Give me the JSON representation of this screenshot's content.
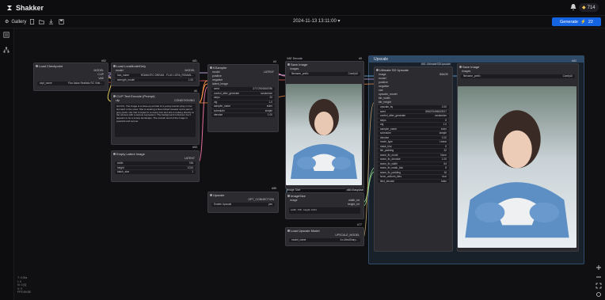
{
  "app": {
    "brand": "Shakker",
    "credits": "714"
  },
  "toolbar": {
    "gallery_label": "Gallery",
    "datetime": "2024-11-13 13:11:00",
    "generate_label": "Generate",
    "generate_cost": "22"
  },
  "stats": [
    "T: 0.09s",
    "I: 0",
    "N: 0 [0]",
    "V: 0",
    "FPS:59.88"
  ],
  "nodes": {
    "load_checkpoint": {
      "id": "#52",
      "title": "Load Checkpoint",
      "outputs": [
        "MODEL",
        "CLIP",
        "VAE"
      ],
      "ckpt_label": "ckpt_name",
      "ckpt_value": "Flux Asian Realistic RC Vide..."
    },
    "load_lora": {
      "id": "#81",
      "title": "Load LoraModelOnly",
      "input": "model",
      "output": "MODEL",
      "lora_label": "lora_name",
      "lora_value": "ROMANTIC DREAM - FLUX LORA_ROMAN...",
      "strength_label": "strength_model",
      "strength_value": "1.00"
    },
    "clip_text": {
      "id": "#6",
      "title": "CLIP Text Encode (Prompt)",
      "input": "clip",
      "output": "CONDITIONING",
      "text": "Girl thin, The image is a close-up portrait of a young woman lying on her stomach in the snow. She is wearing a blue knitted sweater and a pair of grey pants. Her hair is styled in a messy bun and she is looking directly at the camera with a serious expression. The background is blurred, but it appears to be a snowy landscape. The overall mood of the image is peaceful and serene."
    },
    "empty_latent": {
      "id": "#53",
      "title": "Empty Latent Image",
      "output": "LATENT",
      "width_label": "width",
      "width_value": "768",
      "height_label": "height",
      "height_value": "1024",
      "batch_label": "batch_size",
      "batch_value": "1"
    },
    "ksampler": {
      "id": "#3",
      "title": "KSampler",
      "inputs": [
        "model",
        "positive",
        "negative",
        "latent_image"
      ],
      "output": "LATENT",
      "widgets": [
        {
          "label": "seed",
          "value": "37172903060786"
        },
        {
          "label": "control_after_generate",
          "value": "randomize"
        },
        {
          "label": "steps",
          "value": "20"
        },
        {
          "label": "cfg",
          "value": "1.0"
        },
        {
          "label": "sampler_name",
          "value": "euler"
        },
        {
          "label": "scheduler",
          "value": "simple"
        },
        {
          "label": "denoise",
          "value": "1.00"
        }
      ]
    },
    "upscale": {
      "id": "#85",
      "title": "Upscale",
      "output": "OPT_CONNECTION",
      "toggle_label": "Enable Upscale",
      "toggle_value": "yes"
    },
    "vae_decode": {
      "id": "#8",
      "title": "VAE Decode"
    },
    "save_image_1": {
      "id": "#9",
      "title": "Save Image",
      "input": "images",
      "filename_value": "filename_prefix",
      "filename_suffix": "ComfyUI"
    },
    "image_size": {
      "id": "#84",
      "title": "ImageSize",
      "input": "image",
      "outputs": [
        "width_int",
        "height_int"
      ],
      "text": "width: 768 , height: 1024",
      "label": "Image Size"
    },
    "load_upscale_model": {
      "id": "#77",
      "title": "Load Upscale Model",
      "output": "UPSCALE_MODEL",
      "model_label": "model_name",
      "model_value": "4x-UltraSharp..."
    },
    "ultimate_sd_upscale": {
      "id": "#51",
      "title": "Ultimate SD Upscale",
      "badge": "#51 UltimateSDUpscale",
      "output": "IMAGE",
      "inputs": [
        "image",
        "model",
        "positive",
        "negative",
        "vae",
        "upscale_model",
        "tile_width",
        "tile_height"
      ],
      "widgets": [
        {
          "label": "upscale_by",
          "value": "2.00"
        },
        {
          "label": "seed",
          "value": "856079496633917"
        },
        {
          "label": "control_after_generate",
          "value": "randomize"
        },
        {
          "label": "steps",
          "value": "8"
        },
        {
          "label": "cfg",
          "value": "1.0"
        },
        {
          "label": "sampler_name",
          "value": "euler"
        },
        {
          "label": "scheduler",
          "value": "simple"
        },
        {
          "label": "denoise",
          "value": "0.20"
        },
        {
          "label": "mode_type",
          "value": "Linear"
        },
        {
          "label": "mask_blur",
          "value": "8"
        },
        {
          "label": "tile_padding",
          "value": "32"
        },
        {
          "label": "seam_fix_mode",
          "value": "None"
        },
        {
          "label": "seam_fix_denoise",
          "value": "1.00"
        },
        {
          "label": "seam_fix_width",
          "value": "64"
        },
        {
          "label": "seam_fix_mask_blur",
          "value": "8"
        },
        {
          "label": "seam_fix_padding",
          "value": "16"
        },
        {
          "label": "force_uniform_tiles",
          "value": "true"
        },
        {
          "label": "tiled_decode",
          "value": "false"
        }
      ]
    },
    "save_image_2": {
      "id": "#52",
      "title": "Save Image",
      "input": "images",
      "filename_value": "filename_prefix",
      "filename_suffix": "ComfyUI"
    },
    "group": {
      "title": "Upscale"
    },
    "image_size_badge": "#84 EasyUse"
  },
  "colors": {
    "accent": "#1463e3",
    "group": "#2e4a66",
    "wire_model": "#b39fd6",
    "wire_clip": "#e2c95f",
    "wire_cond": "#f28e4a",
    "wire_latent": "#e66f9a",
    "wire_image": "#6fb4e6",
    "wire_vae": "#e05b5b"
  }
}
